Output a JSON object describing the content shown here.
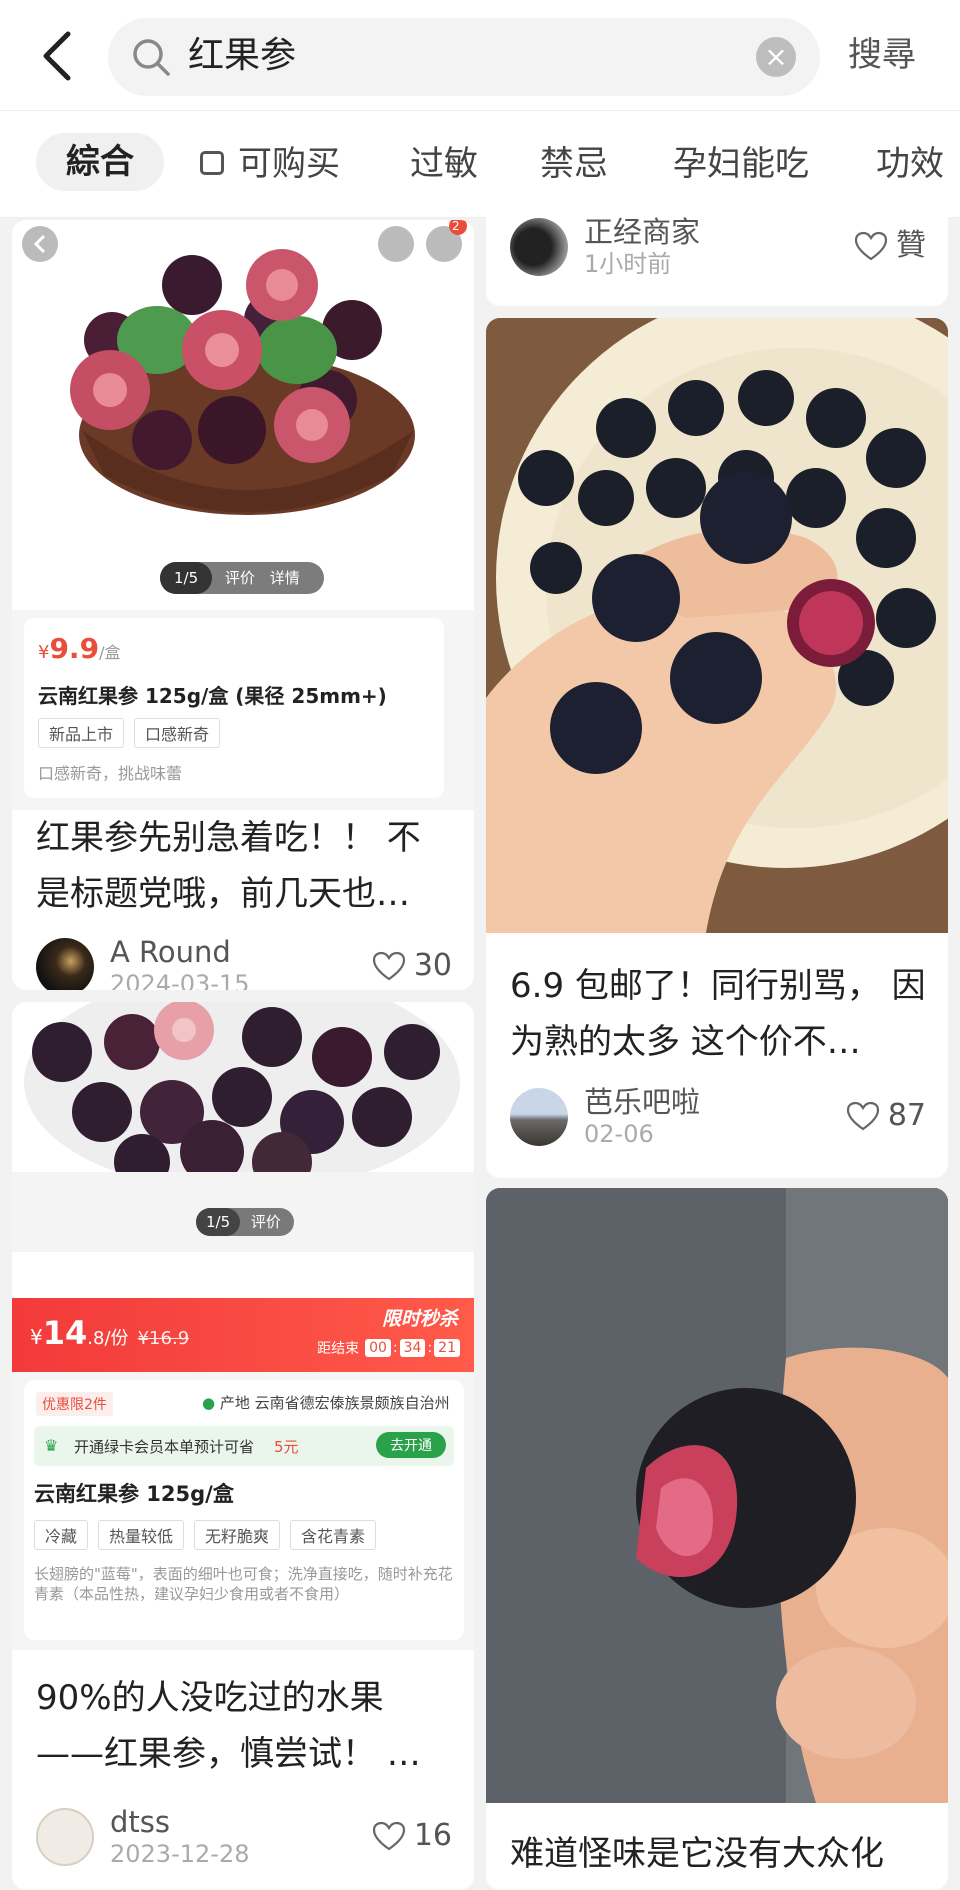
{
  "search": {
    "query": "红果参",
    "submit": "搜尋"
  },
  "tabs": [
    "綜合",
    "可购买",
    "过敏",
    "禁忌",
    "孕妇能吃",
    "功效"
  ],
  "cards": {
    "p1": {
      "indicator": "1/5",
      "ind_review": "评价",
      "ind_detail": "详情",
      "cart_badge": "2",
      "price_symbol": "¥",
      "price": "9.9",
      "price_unit": "/盒",
      "product_name": "云南红果参 125g/盒 (果径 25mm+)",
      "tags": [
        "新品上市",
        "口感新奇"
      ],
      "desc": "口感新奇，挑战味蕾",
      "title": "红果参先别急着吃！！ 不是标题党哦，前几天也…",
      "author": "A Round",
      "date": "2024-03-15",
      "likes": "30"
    },
    "p2": {
      "indicator": "1/5",
      "ind_review": "评价",
      "price_symbol": "¥",
      "price_int": "14",
      "price_dec": ".8/份",
      "price_old": "¥16.9",
      "flash_label": "限时秒杀",
      "countdown_label": "距结束",
      "countdown": [
        "00",
        "34",
        "21"
      ],
      "promo": "优惠限2件",
      "origin": "产地 云南省德宏傣族景颇族自治州",
      "member_text": "开通绿卡会员本单预计可省",
      "member_amount": "5元",
      "member_btn": "去开通",
      "product_name": "云南红果参 125g/盒",
      "tags": [
        "冷藏",
        "热量较低",
        "无籽脆爽",
        "含花青素"
      ],
      "desc": "长翅膀的\"蓝莓\"，表面的细叶也可食；洗净直接吃，随时补充花青素（本品性热，建议孕妇少食用或者不食用）",
      "title": "90%的人没吃过的水果 ——红果参，慎尝试！ …",
      "author": "dtss",
      "date": "2023-12-28",
      "likes": "16"
    },
    "top_right": {
      "author": "正经商家",
      "date": "1小时前",
      "likes": "贊"
    },
    "r1": {
      "title": "6.9 包邮了！同行别骂， 因为熟的太多 这个价不…",
      "author": "芭乐吧啦",
      "date": "02-06",
      "likes": "87"
    },
    "r2": {
      "title": "难道怪味是它没有大众化"
    }
  },
  "colors": {
    "accent_red": "#e94e3a",
    "green": "#2aa14b"
  },
  "icons": [
    "back-arrow-icon",
    "search-icon",
    "clear-icon",
    "heart-icon",
    "share-icon",
    "cart-icon",
    "location-icon"
  ]
}
